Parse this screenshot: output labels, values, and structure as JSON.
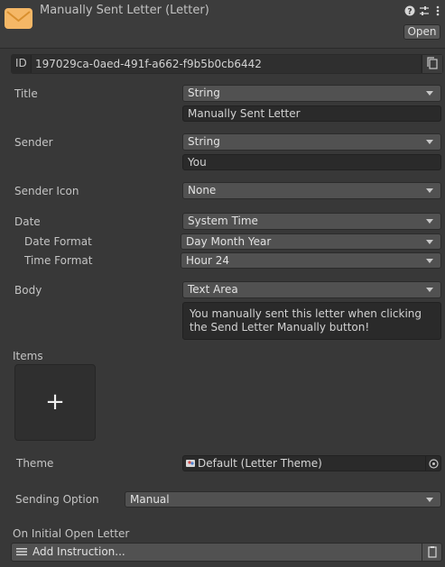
{
  "header": {
    "title": "Manually Sent Letter (Letter)",
    "open_label": "Open",
    "icons": [
      "envelope-icon",
      "help-icon",
      "settings-sliders-icon",
      "more-vert-icon"
    ]
  },
  "id_row": {
    "label": "ID",
    "value": "197029ca-0aed-491f-a662-f9b5b0cb6442"
  },
  "fields": {
    "title": {
      "label": "Title",
      "type": "String",
      "value": "Manually Sent Letter"
    },
    "sender": {
      "label": "Sender",
      "type": "String",
      "value": "You"
    },
    "sender_icon": {
      "label": "Sender Icon",
      "type": "None"
    },
    "date": {
      "label": "Date",
      "type": "System Time",
      "date_format_label": "Date Format",
      "date_format": "Day Month Year",
      "time_format_label": "Time Format",
      "time_format": "Hour 24"
    },
    "body": {
      "label": "Body",
      "type": "Text Area",
      "value": "You manually sent this letter when clicking the Send Letter Manually button!"
    },
    "items": {
      "label": "Items",
      "add_symbol": "+"
    },
    "theme": {
      "label": "Theme",
      "value": "Default (Letter Theme)"
    },
    "sending_option": {
      "label": "Sending Option",
      "value": "Manual"
    },
    "on_initial_open": {
      "label": "On Initial Open Letter",
      "button_label": "Add Instruction..."
    }
  },
  "colors": {
    "accent_envelope": "#f5b766",
    "background": "#383838",
    "dropdown": "#515151",
    "field": "#2a2a2a"
  }
}
